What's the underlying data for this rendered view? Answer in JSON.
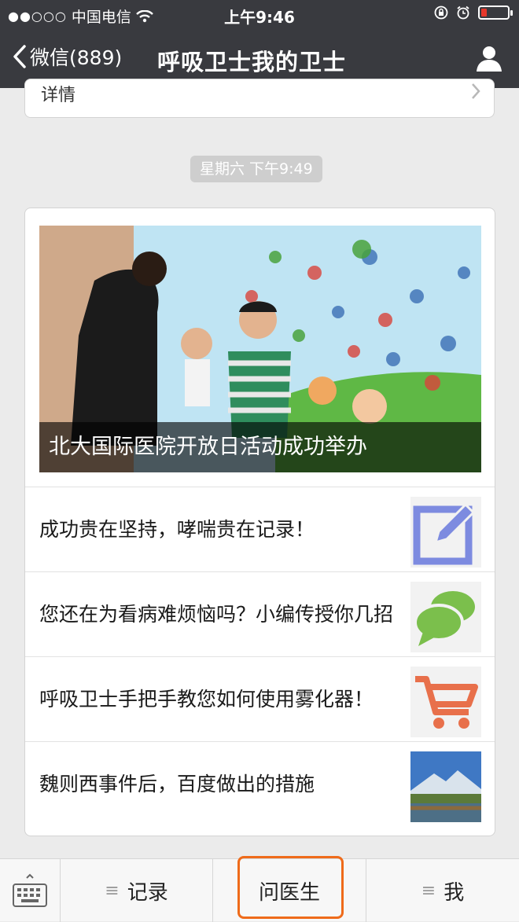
{
  "status_bar": {
    "signal": "●●○○○",
    "carrier": "中国电信",
    "time": "上午9:46"
  },
  "nav": {
    "back_label": "微信(889)",
    "title": "呼吸卫士我的卫士"
  },
  "previous_card": {
    "partial_text": "详情"
  },
  "timestamp": "星期六 下午9:49",
  "news_card": {
    "cover_caption": "北大国际医院开放日活动成功举办",
    "articles": [
      {
        "title": "成功贵在坚持，哮喘贵在记录！",
        "thumb_icon": "edit-icon"
      },
      {
        "title": "您还在为看病难烦恼吗？小编传授你几招",
        "thumb_icon": "chat-bubbles-icon"
      },
      {
        "title": "呼吸卫士手把手教您如何使用雾化器！",
        "thumb_icon": "shopping-cart-icon"
      },
      {
        "title": "魏则西事件后，百度做出的措施",
        "thumb_icon": "landscape-photo"
      }
    ]
  },
  "menu": {
    "items": [
      {
        "label": "记录",
        "has_submenu": true
      },
      {
        "label": "问医生",
        "has_submenu": false
      },
      {
        "label": "我",
        "has_submenu": true
      }
    ],
    "submenu_glyph": "≡"
  },
  "colors": {
    "nav_bg": "#393a3f",
    "highlight": "#ef6b1a",
    "battery_low": "#e6372b"
  }
}
